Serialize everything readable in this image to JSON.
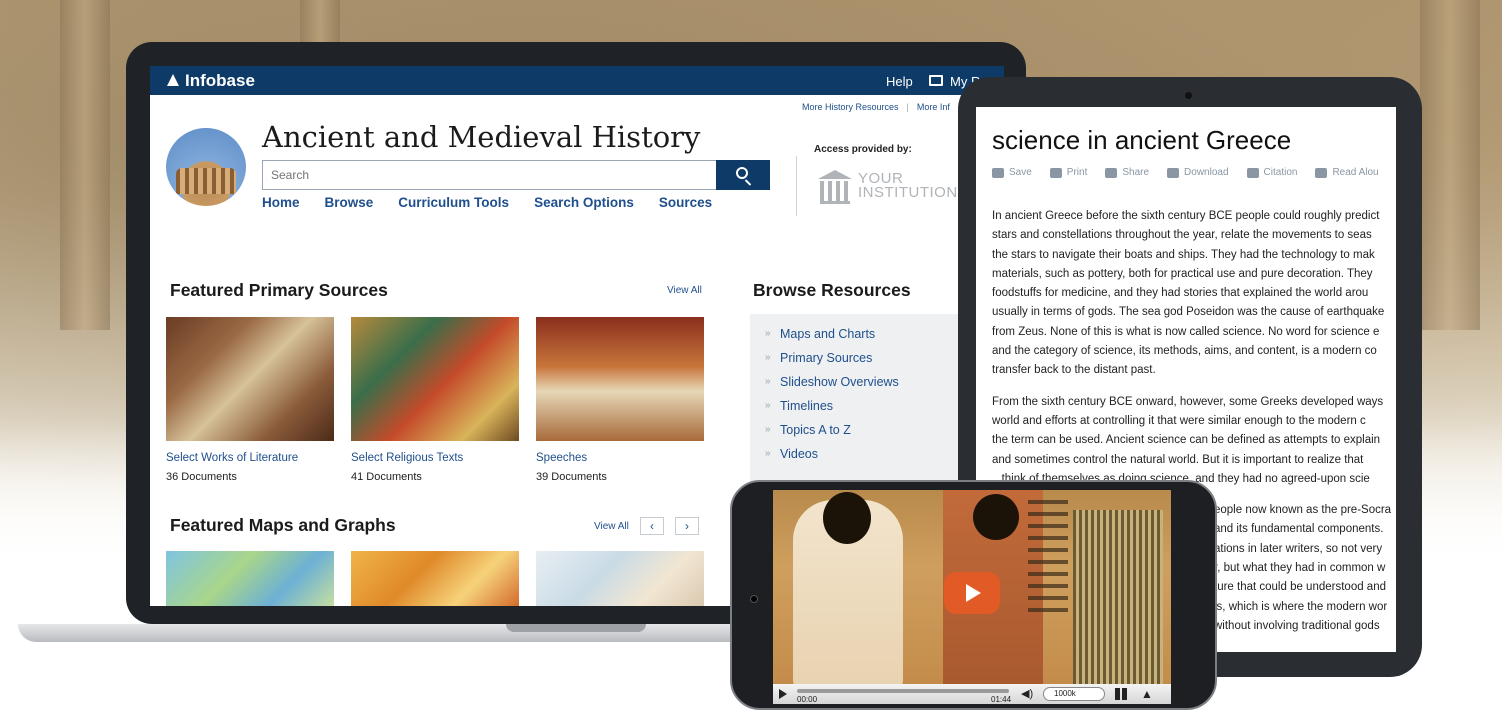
{
  "topbar": {
    "brand": "Infobase",
    "help": "Help",
    "my_research": "My Rese"
  },
  "toplinks": [
    "More History Resources",
    "More Inf"
  ],
  "site": {
    "title": "Ancient and Medieval History",
    "search_placeholder": "Search"
  },
  "nav": [
    "Home",
    "Browse",
    "Curriculum Tools",
    "Search Options",
    "Sources"
  ],
  "access": {
    "label": "Access provided by:",
    "institution_line1": "YOUR",
    "institution_line2": "INSTITUTION"
  },
  "featured_sources": {
    "title": "Featured Primary Sources",
    "view_all": "View All",
    "items": [
      {
        "title": "Select Works of Literature",
        "count": "36 Documents"
      },
      {
        "title": "Select Religious Texts",
        "count": "41 Documents"
      },
      {
        "title": "Speeches",
        "count": "39 Documents"
      }
    ]
  },
  "featured_maps": {
    "title": "Featured Maps and Graphs",
    "view_all": "View All",
    "prev": "‹",
    "next": "›"
  },
  "browse": {
    "title": "Browse Resources",
    "items": [
      "Maps and Charts",
      "Primary Sources",
      "Slideshow Overviews",
      "Timelines",
      "Topics A to Z",
      "Videos"
    ]
  },
  "article": {
    "title": "science in ancient Greece",
    "tools": [
      "Save",
      "Print",
      "Share",
      "Download",
      "Citation",
      "Read Alou"
    ],
    "paragraph1": [
      "In ancient Greece before the sixth century BCE people could roughly predict",
      "stars and constellations throughout the year, relate the movements to seas",
      "the stars to navigate their boats and ships. They had the technology to mak",
      "materials, such as pottery, both for practical use and pure decoration. They",
      "foodstuffs for medicine, and they had stories that explained the world arou",
      "usually in terms of gods. The sea god Poseidon was the cause of earthquake",
      "from Zeus. None of this is what is now called science. No word for science e",
      "and the category of science, its methods, aims, and content, is a modern co",
      "transfer back to the distant past."
    ],
    "paragraph2": [
      "From the sixth century BCE onward, however, some Greeks developed ways",
      "world and efforts at controlling it that were similar enough to the modern c",
      "the term can be used. Ancient science can be defined as attempts to explain",
      "and sometimes control the natural world. But it is important to realize that",
      "...think of themselves as doing science, and they had no agreed-upon scie"
    ],
    "paragraph3": [
      "eople now known as the pre-Socra",
      "and its fundamental components.",
      "ations in later writers, so not very",
      "r, but what they had in common w",
      "ture that could be understood and",
      "is, which is where the modern wor",
      "without involving traditional gods"
    ]
  },
  "video": {
    "time_current": "00:00",
    "time_total": "01:44",
    "quality": "1000k"
  },
  "colors": {
    "navy": "#0e3a68",
    "link": "#1f4f8c",
    "play": "#e25a25"
  }
}
